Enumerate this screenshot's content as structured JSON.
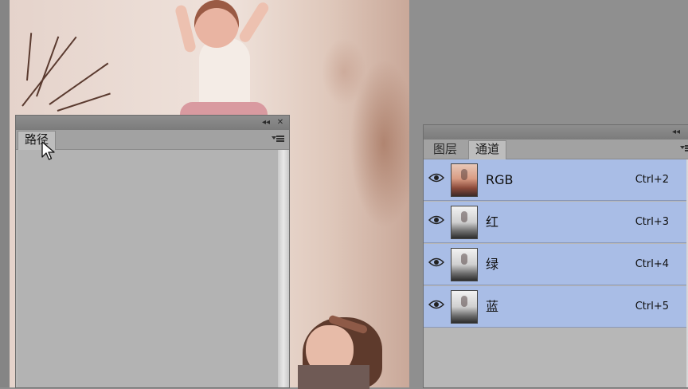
{
  "paths_panel": {
    "collapse_glyph": "◂◂",
    "close_glyph": "✕",
    "tab_label": "路径",
    "menu_icon": "panel-menu-icon"
  },
  "channels_panel": {
    "collapse_glyph": "◂◂",
    "tabs": [
      {
        "label": "图层",
        "active": false
      },
      {
        "label": "通道",
        "active": true
      }
    ],
    "channels": [
      {
        "name": "RGB",
        "shortcut": "Ctrl+2",
        "thumb": "rgb"
      },
      {
        "name": "红",
        "shortcut": "Ctrl+3",
        "thumb": "gray"
      },
      {
        "name": "绿",
        "shortcut": "Ctrl+4",
        "thumb": "gray"
      },
      {
        "name": "蓝",
        "shortcut": "Ctrl+5",
        "thumb": "gray"
      }
    ]
  },
  "colors": {
    "selection": "#a9bde6",
    "panel": "#b8b8b8",
    "header": "#7b7b7b"
  }
}
